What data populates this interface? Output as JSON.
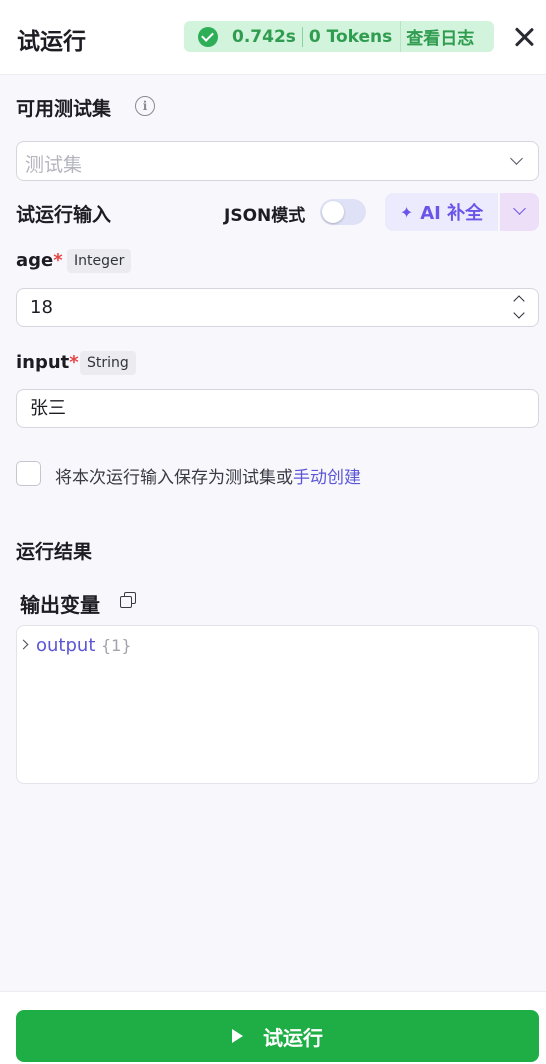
{
  "header": {
    "title": "试运行",
    "status": {
      "duration": "0.742s",
      "tokens": "0 Tokens",
      "log_link": "查看日志"
    }
  },
  "test_set": {
    "label": "可用测试集",
    "placeholder": "测试集"
  },
  "run_input": {
    "label": "试运行输入",
    "json_mode_label": "JSON模式",
    "json_mode_on": false,
    "ai_button_label": "AI 补全"
  },
  "fields": [
    {
      "name": "age",
      "required_mark": "*",
      "type": "Integer",
      "value": "18"
    },
    {
      "name": "input",
      "required_mark": "*",
      "type": "String",
      "value": "张三"
    }
  ],
  "save_option": {
    "checked": false,
    "text": "将本次运行输入保存为测试集或",
    "link": "手动创建"
  },
  "result": {
    "label": "运行结果",
    "output_label": "输出变量",
    "tree": {
      "key": "output",
      "count": "{1}"
    }
  },
  "footer": {
    "run_button_label": "试运行"
  },
  "colors": {
    "accent_green": "#1fae45",
    "status_bg": "#d2f3dc",
    "link": "#5b56d6",
    "ai_accent": "#6b55e8",
    "required": "#e64545"
  }
}
